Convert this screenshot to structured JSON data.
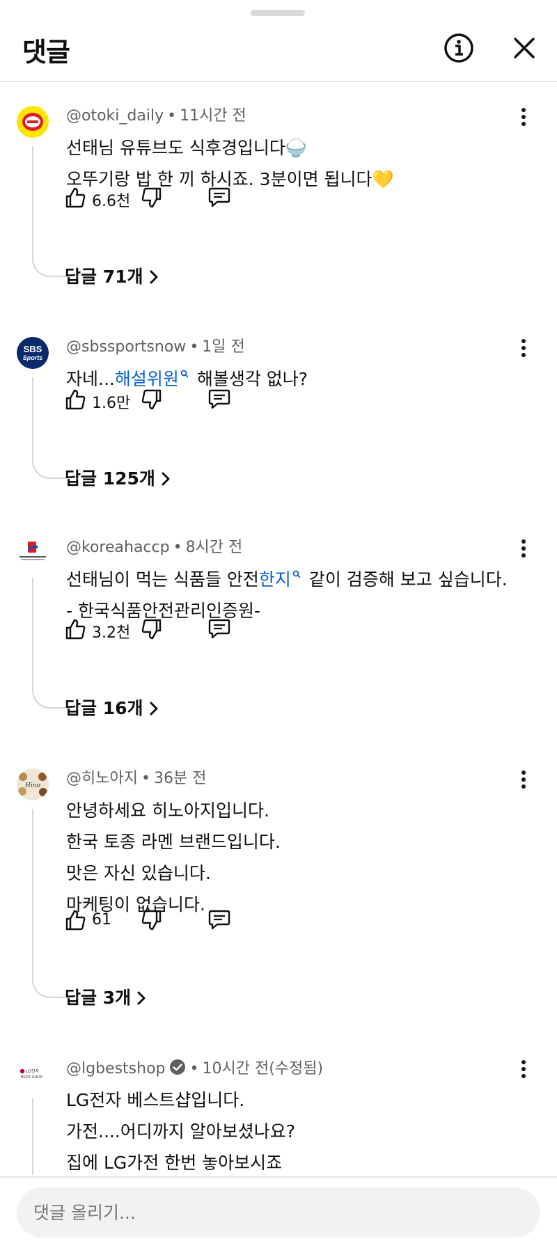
{
  "header": {
    "title": "댓글"
  },
  "comments": [
    {
      "author": "@otoki_daily",
      "time": "11시간 전",
      "lines": [
        "선태님 유튜브도 식후경입니다🍚",
        "오뚜기랑 밥 한 끼 하시죠. 3분이면 됩니다💛"
      ],
      "likes": "6.6천",
      "replies": "답글 71개",
      "avatar_color": "#ffe500"
    },
    {
      "author": "@sbssportsnow",
      "time": "1일 전",
      "text_before": "자네...",
      "link": "해설위원",
      "text_after": "해볼생각 없나?",
      "likes": "1.6만",
      "replies": "답글 125개",
      "avatar_color": "#0a2a6b"
    },
    {
      "author": "@koreahaccp",
      "time": "8시간 전",
      "text_before": "선태님이 먹는 식품들 안전",
      "link": "한지",
      "text_after": "같이 검증해 보고 싶습니다.",
      "line2": "- 한국식품안전관리인증원-",
      "likes": "3.2천",
      "replies": "답글 16개"
    },
    {
      "author": "@히노아지",
      "time": "36분 전",
      "lines": [
        "안녕하세요 히노아지입니다.",
        "한국 토종 라멘 브랜드입니다.",
        "맛은 자신 있습니다.",
        "마케팅이 없습니다."
      ],
      "likes": "61",
      "replies": "답글 3개"
    },
    {
      "author": "@lgbestshop",
      "time": "10시간 전(수정됨)",
      "lines": [
        "LG전자 베스트샵입니다.",
        "가전....어디까지 알아보셨나요?",
        "집에 LG가전 한번 놓아보시죠"
      ]
    }
  ],
  "composer": {
    "placeholder": "댓글 올리기..."
  },
  "colors": {
    "link": "#065fd4",
    "secondary_text": "#606060",
    "composer_bg": "#f2f2f2"
  }
}
